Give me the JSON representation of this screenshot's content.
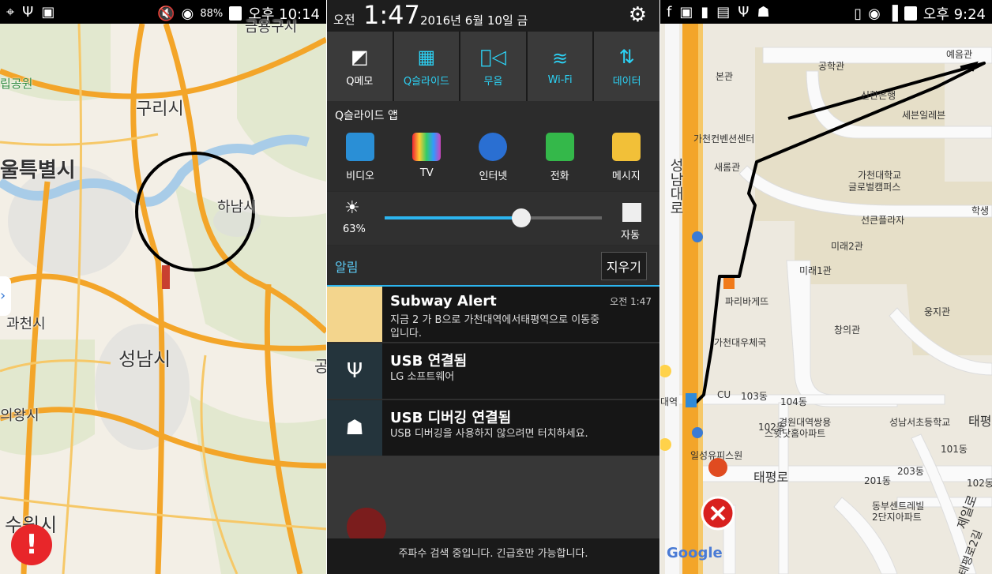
{
  "panel1": {
    "status": {
      "battery": "88%",
      "time": "오후 10:14"
    },
    "labels": [
      "금용구시",
      "립공원",
      "구리시",
      "울특별시",
      "하남시",
      "과천시",
      "성남시",
      "공",
      "의왕시",
      "수원시"
    ]
  },
  "panel2": {
    "header": {
      "ampm": "오전",
      "time": "1:47",
      "date": "2016년 6월 10일 금"
    },
    "quick_tiles": [
      {
        "label": "Q메모",
        "icon": "q-memo-icon"
      },
      {
        "label": "Q슬라이드",
        "icon": "q-slide-icon"
      },
      {
        "label": "무음",
        "icon": "mute-icon"
      },
      {
        "label": "Wi-Fi",
        "icon": "wifi-icon"
      },
      {
        "label": "데이터",
        "icon": "data-icon"
      }
    ],
    "apps_title": "Q슬라이드 앱",
    "apps": [
      {
        "label": "비디오",
        "color": "#2a8fd6"
      },
      {
        "label": "TV",
        "color": "#c94db1"
      },
      {
        "label": "인터넷",
        "color": "#2a6fd2"
      },
      {
        "label": "전화",
        "color": "#34b84a"
      },
      {
        "label": "메시지",
        "color": "#f2c038"
      }
    ],
    "brightness": {
      "percent": "63%",
      "level": 0.63,
      "auto_label": "자동"
    },
    "notifications_title": "알림",
    "clear_label": "지우기",
    "notifications": [
      {
        "title": "Subway Alert",
        "time": "오전 1:47",
        "body": "지금 2 가 B으로 가천대역에서태평역으로 이동중입니다."
      },
      {
        "title": "USB 연결됨",
        "body": "LG 소프트웨어"
      },
      {
        "title": "USB 디버깅 연결됨",
        "body": "USB 디버깅을 사용하지 않으려면 터치하세요."
      }
    ],
    "footer": "주파수 검색 중입니다. 긴급호만 가능합니다."
  },
  "panel3": {
    "status": {
      "time": "오후 9:24"
    },
    "labels": [
      "공학관",
      "예음관",
      "본관",
      "신한은행",
      "세븐일레븐",
      "가천컨벤션센터",
      "새롬관",
      "가천대학교",
      "글로벌캠퍼스",
      "선큰플라자",
      "학생",
      "미래2관",
      "미래1관",
      "파리바게뜨",
      "웅지관",
      "창의관",
      "가천대우체국",
      "성남대로",
      "CU",
      "103동",
      "104동",
      "대역",
      "102동",
      "경원대역쌍용",
      "스윗닷홈아파트",
      "성남서초등학교",
      "태평",
      "101동",
      "일성유피스원",
      "태평로",
      "203동",
      "201동",
      "102동",
      "동부센트레빌",
      "2단지아파트",
      "제일로",
      "태평로2길"
    ],
    "google": "Google"
  }
}
